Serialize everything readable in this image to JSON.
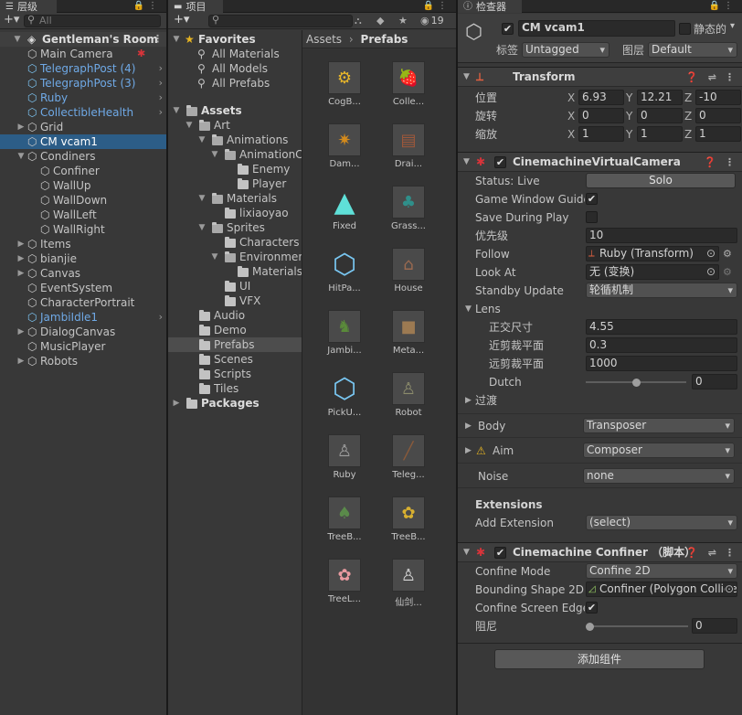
{
  "hierarchy": {
    "tab_label": "层级",
    "search_placeholder": "All",
    "scene_name": "Gentleman's Room",
    "items": [
      {
        "label": "Main Camera",
        "indent": 1,
        "blue": false,
        "expand": "",
        "chevron": false
      },
      {
        "label": "TelegraphPost (4)",
        "indent": 1,
        "blue": true,
        "expand": "",
        "chevron": true
      },
      {
        "label": "TelegraphPost (3)",
        "indent": 1,
        "blue": true,
        "expand": "",
        "chevron": true
      },
      {
        "label": "Ruby",
        "indent": 1,
        "blue": true,
        "expand": "",
        "chevron": true
      },
      {
        "label": "CollectibleHealth",
        "indent": 1,
        "blue": true,
        "expand": "",
        "chevron": true
      },
      {
        "label": "Grid",
        "indent": 1,
        "blue": false,
        "expand": "▶",
        "chevron": false
      },
      {
        "label": "CM vcam1",
        "indent": 1,
        "blue": false,
        "expand": "",
        "chevron": false,
        "selected": true
      },
      {
        "label": "Condiners",
        "indent": 1,
        "blue": false,
        "expand": "▼",
        "chevron": false
      },
      {
        "label": "Confiner",
        "indent": 2,
        "blue": false,
        "expand": "",
        "chevron": false
      },
      {
        "label": "WallUp",
        "indent": 2,
        "blue": false,
        "expand": "",
        "chevron": false
      },
      {
        "label": "WallDown",
        "indent": 2,
        "blue": false,
        "expand": "",
        "chevron": false
      },
      {
        "label": "WallLeft",
        "indent": 2,
        "blue": false,
        "expand": "",
        "chevron": false
      },
      {
        "label": "WallRight",
        "indent": 2,
        "blue": false,
        "expand": "",
        "chevron": false
      },
      {
        "label": "Items",
        "indent": 1,
        "blue": false,
        "expand": "▶",
        "chevron": false
      },
      {
        "label": "bianjie",
        "indent": 1,
        "blue": false,
        "expand": "▶",
        "chevron": false
      },
      {
        "label": "Canvas",
        "indent": 1,
        "blue": false,
        "expand": "▶",
        "chevron": false
      },
      {
        "label": "EventSystem",
        "indent": 1,
        "blue": false,
        "expand": "",
        "chevron": false
      },
      {
        "label": "CharacterPortrait",
        "indent": 1,
        "blue": false,
        "expand": "",
        "chevron": false
      },
      {
        "label": "JambiIdle1",
        "indent": 1,
        "blue": true,
        "expand": "",
        "chevron": true
      },
      {
        "label": "DialogCanvas",
        "indent": 1,
        "blue": false,
        "expand": "▶",
        "chevron": false
      },
      {
        "label": "MusicPlayer",
        "indent": 1,
        "blue": false,
        "expand": "",
        "chevron": false
      },
      {
        "label": "Robots",
        "indent": 1,
        "blue": false,
        "expand": "▶",
        "chevron": false
      }
    ]
  },
  "project": {
    "tab_label": "项目",
    "add_label": "+",
    "hidden_count": "19",
    "favorites_label": "Favorites",
    "favorites": [
      "All Materials",
      "All Models",
      "All Prefabs"
    ],
    "tree": [
      {
        "label": "Assets",
        "indent": 0,
        "expand": "▼",
        "bold": true
      },
      {
        "label": "Art",
        "indent": 1,
        "expand": "▼"
      },
      {
        "label": "Animations",
        "indent": 2,
        "expand": "▼"
      },
      {
        "label": "AnimationClips",
        "indent": 3,
        "expand": "▼"
      },
      {
        "label": "Enemy",
        "indent": 4,
        "expand": ""
      },
      {
        "label": "Player",
        "indent": 4,
        "expand": ""
      },
      {
        "label": "Materials",
        "indent": 2,
        "expand": "▼"
      },
      {
        "label": "lixiaoyao",
        "indent": 3,
        "expand": ""
      },
      {
        "label": "Sprites",
        "indent": 2,
        "expand": "▼"
      },
      {
        "label": "Characters",
        "indent": 3,
        "expand": ""
      },
      {
        "label": "Environment",
        "indent": 3,
        "expand": "▼"
      },
      {
        "label": "Materials",
        "indent": 4,
        "expand": ""
      },
      {
        "label": "UI",
        "indent": 3,
        "expand": ""
      },
      {
        "label": "VFX",
        "indent": 3,
        "expand": ""
      },
      {
        "label": "Audio",
        "indent": 1,
        "expand": ""
      },
      {
        "label": "Demo",
        "indent": 1,
        "expand": ""
      },
      {
        "label": "Prefabs",
        "indent": 1,
        "expand": "",
        "selected": true
      },
      {
        "label": "Scenes",
        "indent": 1,
        "expand": ""
      },
      {
        "label": "Scripts",
        "indent": 1,
        "expand": ""
      },
      {
        "label": "Tiles",
        "indent": 1,
        "expand": ""
      },
      {
        "label": "Packages",
        "indent": 0,
        "expand": "▶",
        "bold": true
      }
    ],
    "breadcrumb": [
      "Assets",
      "Prefabs"
    ],
    "prefabs": [
      {
        "label": "CogB...",
        "icon": "⚙",
        "color": "#e8b62a"
      },
      {
        "label": "Colle...",
        "icon": "🍓",
        "color": "#d8343a"
      },
      {
        "label": "Dam...",
        "icon": "✷",
        "color": "#d38a1c"
      },
      {
        "label": "Drai...",
        "icon": "▤",
        "color": "#a0583a"
      },
      {
        "label": "Fixed",
        "icon": "▲",
        "color": "#5fe0d8"
      },
      {
        "label": "Grass...",
        "icon": "♣",
        "color": "#2f8f8a"
      },
      {
        "label": "HitPa...",
        "icon": "⬡",
        "color": "#79c7f2"
      },
      {
        "label": "House",
        "icon": "⌂",
        "color": "#9a6a50"
      },
      {
        "label": "Jambi...",
        "icon": "♞",
        "color": "#5a8a3a"
      },
      {
        "label": "Meta...",
        "icon": "■",
        "color": "#9c7a52"
      },
      {
        "label": "PickU...",
        "icon": "⬡",
        "color": "#79c7f2"
      },
      {
        "label": "Robot",
        "icon": "♙",
        "color": "#8c8c6c"
      },
      {
        "label": "Ruby",
        "icon": "♙",
        "color": "#a0a0a0"
      },
      {
        "label": "Teleg...",
        "icon": "╱",
        "color": "#8a5a3a"
      },
      {
        "label": "TreeB...",
        "icon": "♠",
        "color": "#5a8a4a"
      },
      {
        "label": "TreeB...",
        "icon": "✿",
        "color": "#d8b030"
      },
      {
        "label": "TreeL...",
        "icon": "✿",
        "color": "#e89aa0"
      },
      {
        "label": "仙剑...",
        "icon": "♙",
        "color": "#d8d8d8"
      }
    ]
  },
  "inspector": {
    "tab_label": "检查器",
    "object_name": "CM vcam1",
    "static_label": "静态的",
    "tag_label": "标签",
    "tag_value": "Untagged",
    "layer_label": "图层",
    "layer_value": "Default",
    "transform": {
      "title": "Transform",
      "rows": [
        {
          "label": "位置",
          "x": "6.93",
          "y": "12.21",
          "z": "-10"
        },
        {
          "label": "旋转",
          "x": "0",
          "y": "0",
          "z": "0"
        },
        {
          "label": "缩放",
          "x": "1",
          "y": "1",
          "z": "1"
        }
      ]
    },
    "vcam": {
      "title": "CinemachineVirtualCamera",
      "status_label": "Status: Live",
      "solo_label": "Solo",
      "game_window_label": "Game Window Guides",
      "game_window_checked": "✔",
      "save_during_play_label": "Save During Play",
      "priority_label": "优先级",
      "priority_value": "10",
      "follow_label": "Follow",
      "follow_value": "Ruby (Transform)",
      "lookat_label": "Look At",
      "lookat_value": "无 (变换)",
      "standby_label": "Standby Update",
      "standby_value": "轮循机制",
      "lens_label": "Lens",
      "ortho_label": "正交尺寸",
      "ortho_value": "4.55",
      "near_label": "近剪裁平面",
      "near_value": "0.3",
      "far_label": "远剪裁平面",
      "far_value": "1000",
      "dutch_label": "Dutch",
      "dutch_value": "0",
      "transition_label": "过渡",
      "body_label": "Body",
      "body_value": "Transposer",
      "aim_label": "Aim",
      "aim_value": "Composer",
      "noise_label": "Noise",
      "noise_value": "none",
      "extensions_label": "Extensions",
      "add_extension_label": "Add Extension",
      "add_extension_value": "(select)"
    },
    "confiner": {
      "title": "Cinemachine Confiner （脚本）",
      "mode_label": "Confine Mode",
      "mode_value": "Confine 2D",
      "shape_label": "Bounding Shape 2D",
      "shape_value": "Confiner (Polygon Collider",
      "screen_edges_label": "Confine Screen Edges",
      "screen_edges_checked": "✔",
      "damping_label": "阻尼",
      "damping_value": "0"
    },
    "add_component_label": "添加组件"
  }
}
